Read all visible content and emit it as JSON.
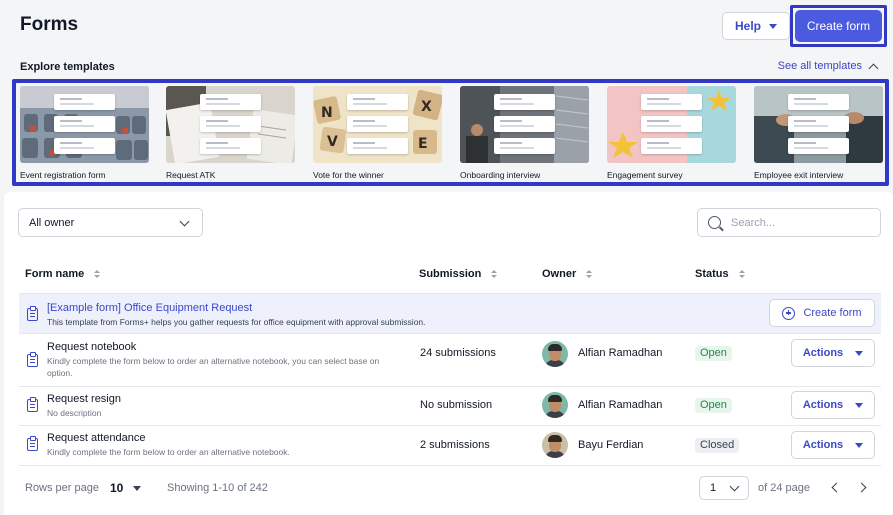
{
  "header": {
    "title": "Forms",
    "help_label": "Help",
    "create_form_label": "Create form"
  },
  "templates": {
    "title": "Explore templates",
    "see_all_label": "See all templates",
    "items": [
      {
        "label": "Event registration form",
        "image": "conference-seats"
      },
      {
        "label": "Request ATK",
        "image": "office-papers"
      },
      {
        "label": "Vote for the winner",
        "image": "letter-tiles"
      },
      {
        "label": "Onboarding interview",
        "image": "office-building"
      },
      {
        "label": "Engagement survey",
        "image": "pink-stars"
      },
      {
        "label": "Employee exit interview",
        "image": "handshake"
      }
    ]
  },
  "filters": {
    "owner_select": "All owner",
    "search_placeholder": "Search..."
  },
  "table": {
    "columns": [
      "Form name",
      "Submission",
      "Owner",
      "Status"
    ],
    "example_row": {
      "name": "[Example form] Office Equipment Request",
      "description": "This template from Forms+ helps you gather requests for office equipment with approval submission.",
      "create_label": "Create form"
    },
    "rows": [
      {
        "name": "Request notebook",
        "description": "Kindly complete the form below to order an alternative notebook, you can select base on option.",
        "submission": "24 submissions",
        "owner": "Alfian Ramadhan",
        "status": "Open",
        "actions_label": "Actions"
      },
      {
        "name": "Request resign",
        "description": "No description",
        "submission": "No submission",
        "owner": "Alfian Ramadhan",
        "status": "Open",
        "actions_label": "Actions"
      },
      {
        "name": "Request attendance",
        "description": "Kindly complete the form below to order an alternative notebook.",
        "submission": "2 submissions",
        "owner": "Bayu Ferdian",
        "status": "Closed",
        "actions_label": "Actions"
      }
    ]
  },
  "footer": {
    "rows_per_page_label": "Rows per page",
    "rows_per_page_value": "10",
    "showing": "Showing 1-10 of 242",
    "page_value": "1",
    "of_pages": "of 24 page"
  },
  "colors": {
    "accent": "#4b5be0",
    "link": "#3b48c8",
    "highlight_border": "#3038c4",
    "open_status": "#1e8a45",
    "example_row_bg": "#eef0fc"
  }
}
